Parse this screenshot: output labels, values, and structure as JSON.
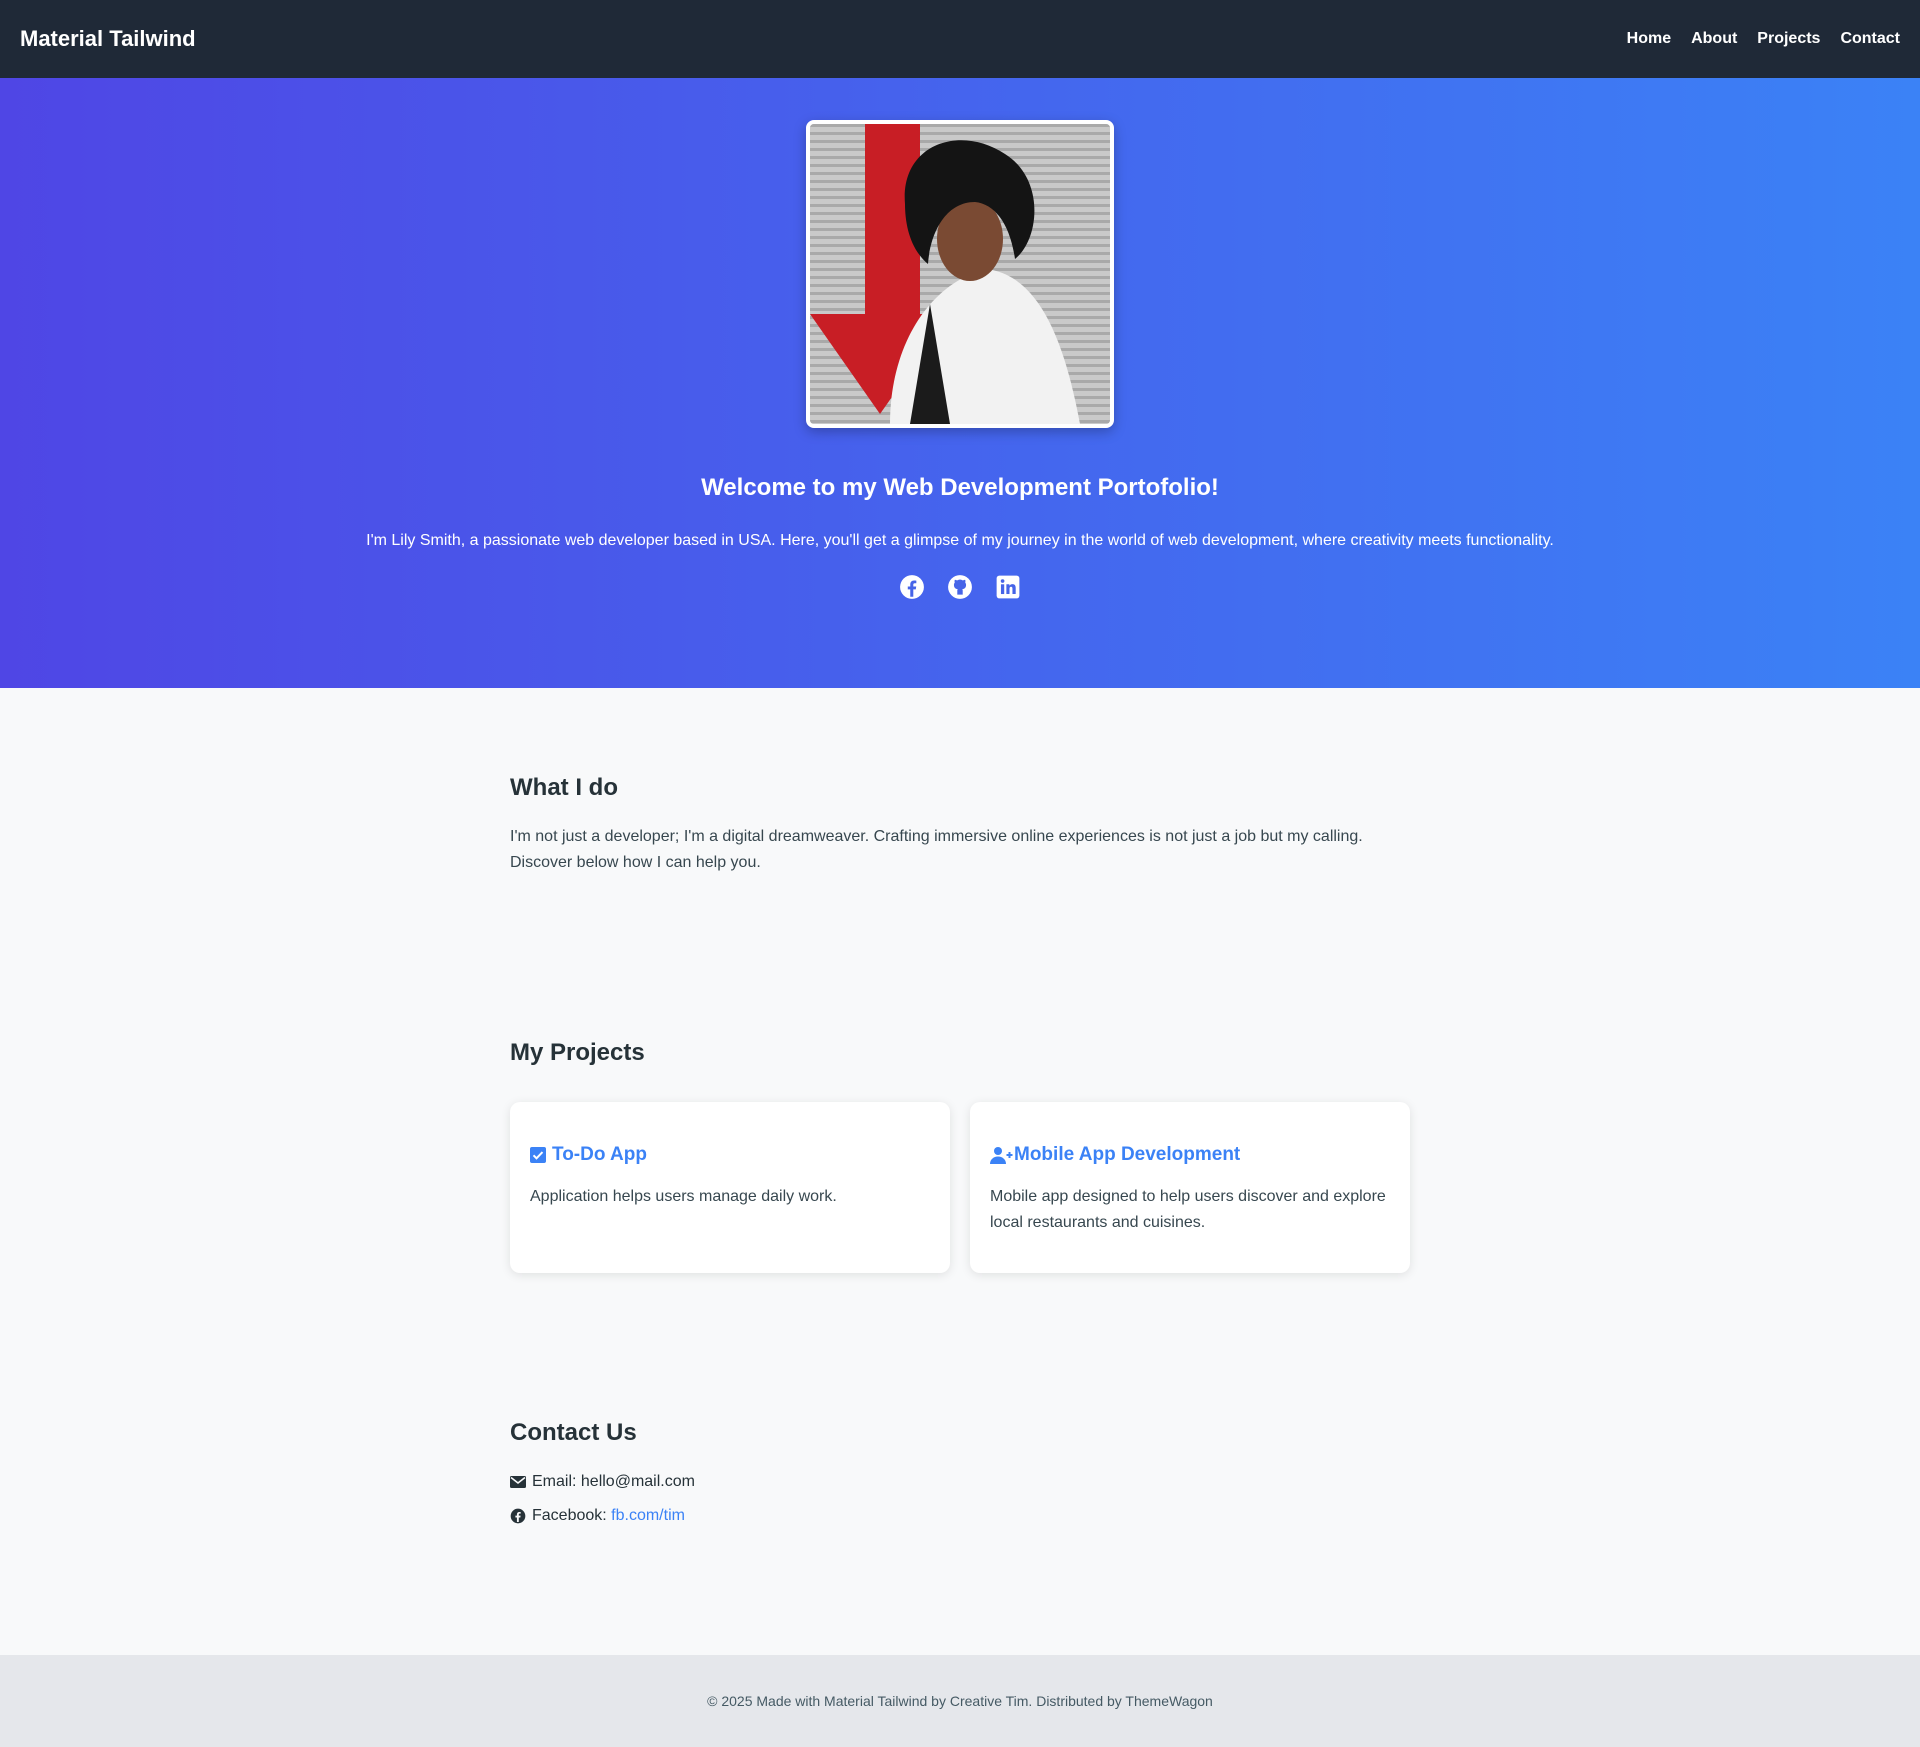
{
  "navbar": {
    "brand": "Material Tailwind",
    "links": [
      "Home",
      "About",
      "Projects",
      "Contact"
    ]
  },
  "hero": {
    "title": "Welcome to my Web Development Portofolio!",
    "text": "I'm Lily Smith, a passionate web developer based in USA. Here, you'll get a glimpse of my journey in the world of web development, where creativity meets functionality.",
    "socials": [
      "facebook-icon",
      "github-icon",
      "linkedin-icon"
    ]
  },
  "about": {
    "title": "What I do",
    "text_line1": "I'm not just a developer; I'm a digital dreamweaver. Crafting immersive online experiences is not just a job but my calling.",
    "text_line2": "Discover below how I can help you."
  },
  "projects": {
    "title": "My Projects",
    "items": [
      {
        "icon": "checkbox-icon",
        "title": "To-Do App",
        "text": "Application helps users manage daily work."
      },
      {
        "icon": "user-plus-icon",
        "title": "Mobile App Development",
        "text": "Mobile app designed to help users discover and explore local restaurants and cuisines."
      }
    ]
  },
  "contact": {
    "title": "Contact Us",
    "email_label": "Email: hello@mail.com",
    "facebook_label": "Facebook: ",
    "facebook_link": "fb.com/tim"
  },
  "footer": {
    "text": "© 2025 Made with Material Tailwind by Creative Tim. Distributed by ThemeWagon"
  },
  "colors": {
    "navbar": "#1f2937",
    "hero_start": "#4f46e5",
    "hero_end": "#3b82f6",
    "accent": "#3b82f6",
    "footer": "#e5e7eb"
  }
}
